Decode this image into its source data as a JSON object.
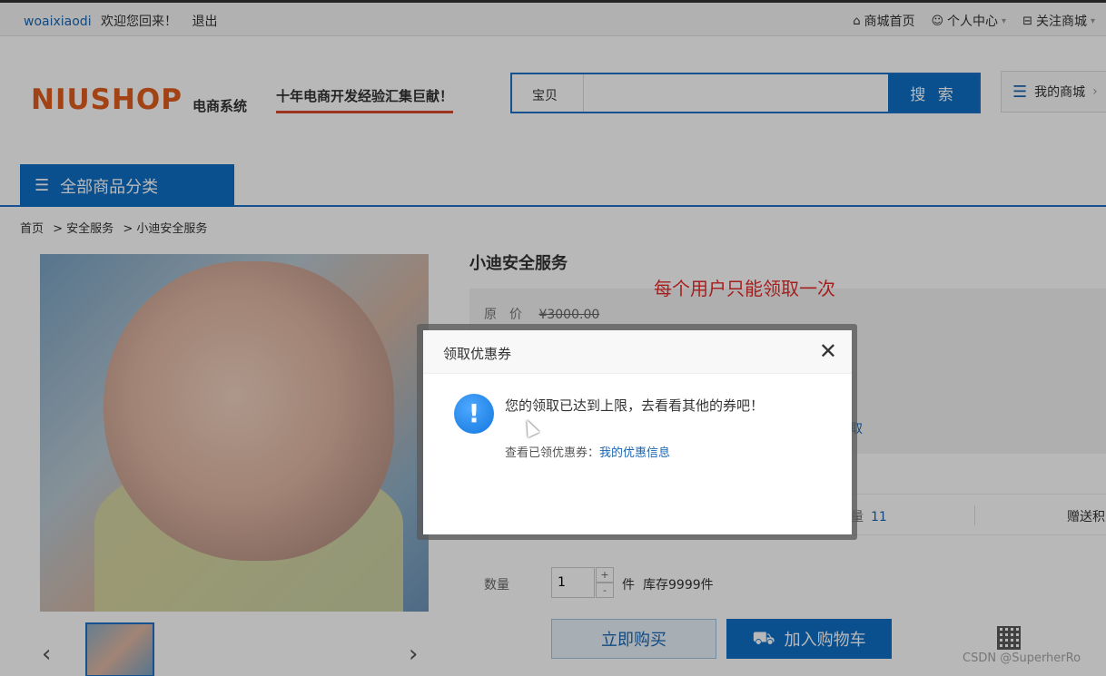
{
  "topbar": {
    "username": "woaixiaodi",
    "welcome": "欢迎您回来！",
    "logout": "退出",
    "links": [
      "商城首页",
      "个人中心",
      "关注商城"
    ]
  },
  "header": {
    "logo_text": "NIUSHOP",
    "logo_suffix": "电商系统",
    "slogan": "十年电商开发经验汇集巨献！",
    "search_type": "宝贝",
    "search_value": "",
    "search_button": "搜 索",
    "my_shop": "我的商城"
  },
  "nav": {
    "category_button": "全部商品分类"
  },
  "breadcrumb": [
    "首页",
    "> 安全服务",
    "> 小迪安全服务"
  ],
  "product": {
    "title": "小迪安全服务",
    "annotation": "每个用户只能领取一次",
    "price_label": "原　价",
    "original_price": "¥3000.00",
    "coupon_link_fragment": "取",
    "sales_label": "量",
    "sales_value": "11",
    "points_label": "赠送积",
    "quantity_label": "数量",
    "quantity_value": "1",
    "quantity_plus": "+",
    "quantity_minus": "-",
    "unit": "件",
    "stock": "库存9999件",
    "buy_now": "立即购买",
    "add_to_cart": "加入购物车"
  },
  "modal": {
    "title": "领取优惠券",
    "close": "✕",
    "icon": "!",
    "message": "您的领取已达到上限，去看看其他的券吧！",
    "sub_label": "查看已领优惠券：",
    "sub_link": "我的优惠信息"
  },
  "watermark": "CSDN @SuperherRo",
  "colors": {
    "brand_blue": "#0f6fc6",
    "link_blue": "#1a66b3",
    "annotation_red": "#e62b2b",
    "logo_orange": "#e05d1c"
  }
}
